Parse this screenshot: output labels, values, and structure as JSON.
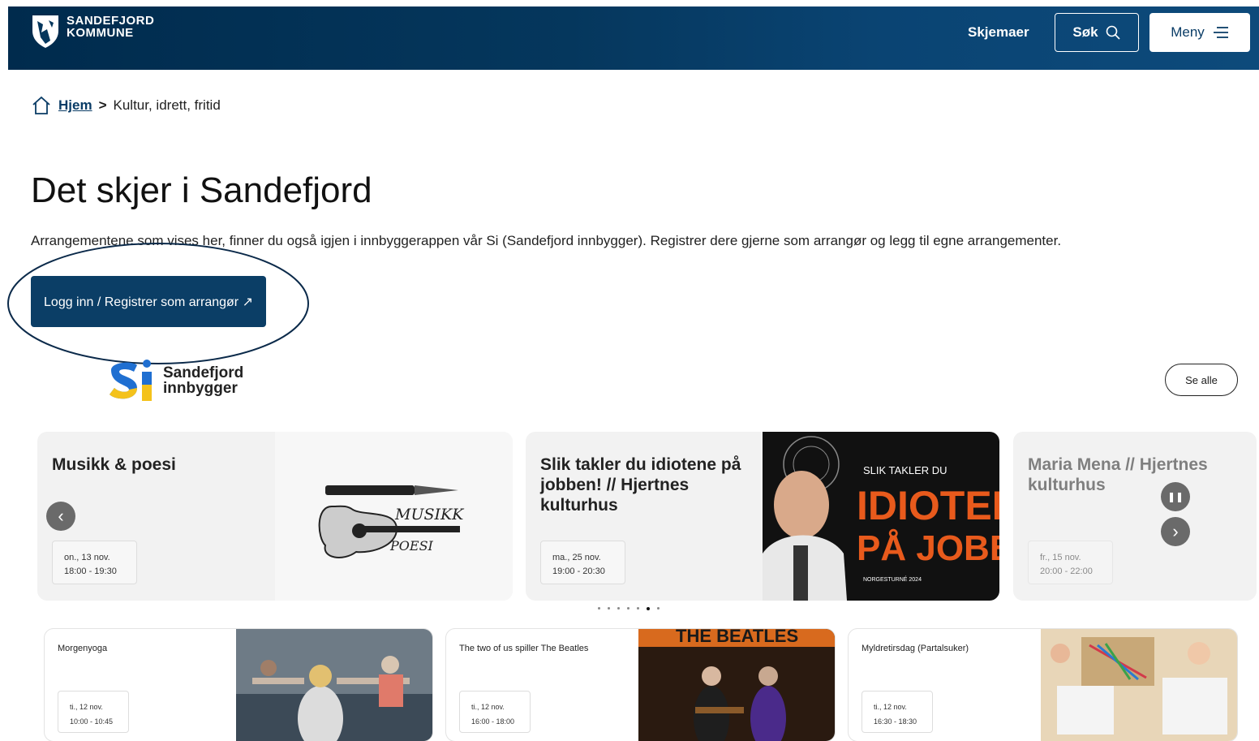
{
  "header": {
    "logo_line1": "SANDEFJORD",
    "logo_line2": "KOMMUNE",
    "forms_link": "Skjemaer",
    "search_label": "Søk",
    "menu_label": "Meny",
    "bg_color": "#05375d"
  },
  "breadcrumb": {
    "home": "Hjem",
    "separator": ">",
    "current": "Kultur, idrett, fritid"
  },
  "page": {
    "title": "Det skjer i Sandefjord",
    "intro": "Arrangementene som vises her, finner du også igjen i innbyggerappen vår Si (Sandefjord innbygger). Registrer dere gjerne som arrangør og legg til egne arrangementer.",
    "login_button": "Logg inn / Registrer som arrangør ↗"
  },
  "si_logo": {
    "mark": "Si",
    "line1": "Sandefjord",
    "line2": "innbygger"
  },
  "see_all": "Se alle",
  "carousel": {
    "cards": [
      {
        "title": "Musikk & poesi",
        "date": "on., 13 nov.",
        "time": "18:00 - 19:30",
        "image_text_1": "MUSIKK",
        "image_text_2": "POESI"
      },
      {
        "title": "Slik takler du idiotene på jobben! // Hjertnes kulturhus",
        "date": "ma., 25 nov.",
        "time": "19:00 - 20:30",
        "image_small": "SLIK TAKLER DU",
        "image_big1": "IDIOTEN",
        "image_big2": "PÅ JOBBE",
        "image_footer": "NORGESTURNÉ 2024"
      },
      {
        "title": "Maria Mena // Hjertnes kulturhus",
        "date": "fr., 15 nov.",
        "time": "20:00 - 22:00"
      }
    ],
    "prev_icon": "‹",
    "next_icon": "›",
    "pause_icon": "❚❚",
    "dot_count": 7,
    "active_dot": 6
  },
  "small_cards": [
    {
      "title": "Morgenyoga",
      "date": "ti., 12 nov.",
      "time": "10:00 - 10:45"
    },
    {
      "title": "The two of us spiller The Beatles",
      "date": "ti., 12 nov.",
      "time": "16:00 - 18:00",
      "image_text": "THE BEATLES"
    },
    {
      "title": "Myldretirsdag (Partalsuker)",
      "date": "ti., 12 nov.",
      "time": "16:30 - 18:30"
    }
  ]
}
